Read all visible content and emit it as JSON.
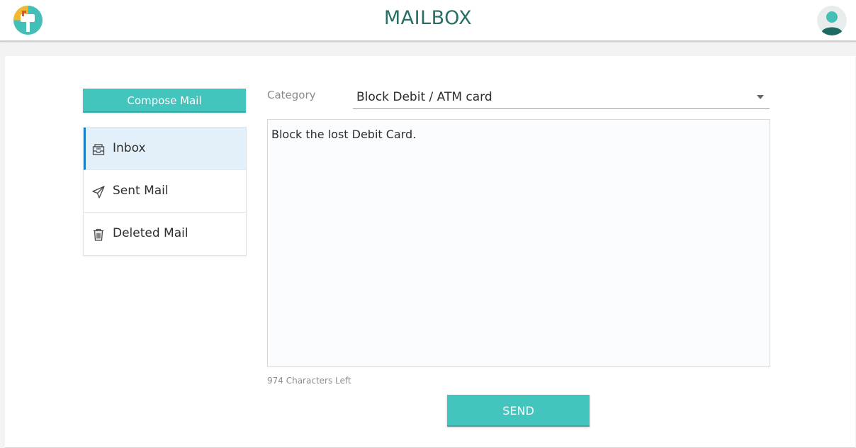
{
  "header": {
    "title": "MAILBOX",
    "logo_icon": "mailbox-logo-icon",
    "avatar_icon": "user-avatar-icon"
  },
  "sidebar": {
    "compose_label": "Compose Mail",
    "items": [
      {
        "label": "Inbox",
        "icon": "inbox-icon",
        "active": true
      },
      {
        "label": "Sent Mail",
        "icon": "paper-plane-icon",
        "active": false
      },
      {
        "label": "Deleted Mail",
        "icon": "trash-icon",
        "active": false
      }
    ]
  },
  "compose": {
    "category_label": "Category",
    "category_value": "Block Debit / ATM card",
    "message": "Block the lost Debit Card.",
    "chars_left": "974 Characters Left",
    "send_label": "SEND"
  },
  "colors": {
    "accent": "#43c4bd",
    "title": "#2a6e66",
    "active_nav_bg": "#e3f0fa",
    "active_nav_border": "#1e7fc6"
  }
}
